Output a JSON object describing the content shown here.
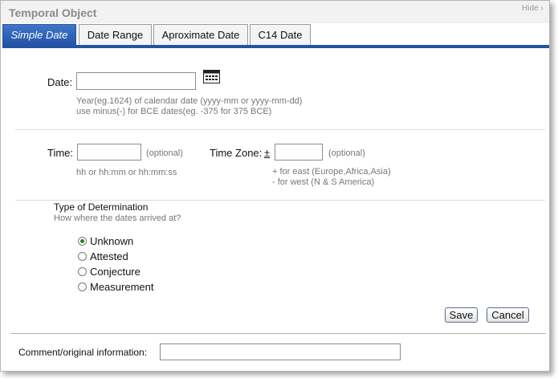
{
  "dialog": {
    "title": "Temporal Object",
    "hide_label": "Hide ›"
  },
  "tabs": [
    {
      "label": "Simple Date",
      "active": true
    },
    {
      "label": "Date Range",
      "active": false
    },
    {
      "label": "Aproximate Date",
      "active": false
    },
    {
      "label": "C14 Date",
      "active": false
    }
  ],
  "date": {
    "label": "Date:",
    "value": "",
    "hint_line1": "Year(eg.1624) of calendar date (yyyy-mm or yyyy-mm-dd)",
    "hint_line2": "use minus(-) for BCE dates(eg. -375 for 375 BCE)",
    "calendar_icon": "calendar-icon"
  },
  "time": {
    "label": "Time:",
    "value": "",
    "optional": "(optional)",
    "hint": "hh or hh:mm or hh:mm:ss"
  },
  "timezone": {
    "label": "Time Zone:",
    "sign": "±",
    "value": "",
    "optional": "(optional)",
    "hint_line1": "+ for east (Europe,Africa,Asia)",
    "hint_line2": "- for west (N & S America)"
  },
  "determination": {
    "title": "Type of Determination",
    "subtitle": "How where the dates arrived at?",
    "options": [
      {
        "label": "Unknown",
        "selected": true
      },
      {
        "label": "Attested",
        "selected": false
      },
      {
        "label": "Conjecture",
        "selected": false
      },
      {
        "label": "Measurement",
        "selected": false
      }
    ]
  },
  "buttons": {
    "save": "Save",
    "cancel": "Cancel"
  },
  "comment": {
    "label": "Comment/original information:",
    "value": ""
  },
  "colors": {
    "accent": "#2453a6",
    "radio_selected": "#2e7d2e"
  }
}
